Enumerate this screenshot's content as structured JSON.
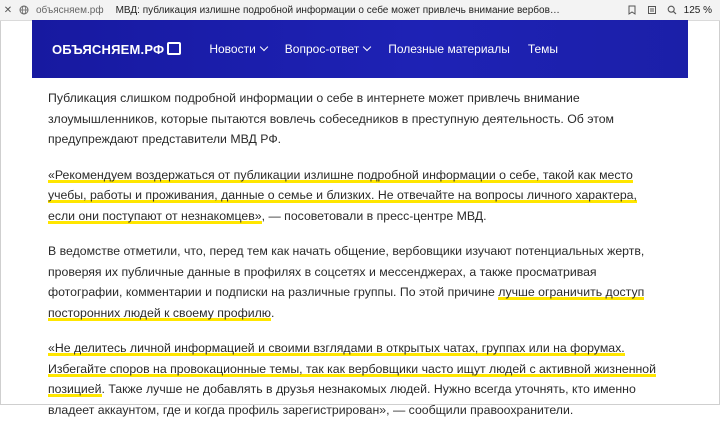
{
  "browser": {
    "url": "объясняем.рф",
    "tab_title": "МВД: публикация излишне подробной информации о себе может привлечь внимание вербовщик...",
    "zoom": "125 %",
    "icons": [
      "close-icon",
      "globe-icon",
      "bookmark-icon",
      "reader-icon",
      "search-icon"
    ]
  },
  "site": {
    "logo": "ОБЪЯСНЯЕМ.РФ",
    "nav": [
      {
        "label": "Новости",
        "has_dropdown": true
      },
      {
        "label": "Вопрос-ответ",
        "has_dropdown": true
      },
      {
        "label": "Полезные материалы",
        "has_dropdown": false
      },
      {
        "label": "Темы",
        "has_dropdown": false
      }
    ],
    "header_color": "#1a1fa8",
    "highlight_color": "#ffe600"
  },
  "article": {
    "p1": [
      "Публикация слишком подробной информации о себе в интернете может привлечь внимание",
      "злоумышленников, которые пытаются вовлечь собеседников в преступную деятельность. Об этом",
      "предупреждают представители МВД РФ."
    ],
    "p2": {
      "l1": "«Рекомендуем воздержаться от публикации излишне подробной информации о себе, такой как место",
      "l2": "учебы, работы и проживания, данные о семье и близких. Не отвечайте на вопросы личного характера,",
      "l3_hl": "если они поступают от незнакомцев»",
      "l3_rest": ", — посоветовали в пресс-центре МВД."
    },
    "p3": {
      "l1": "В ведомстве отметили, что, перед тем как начать общение, вербовщики изучают потенциальных жертв,",
      "l2": "проверяя их публичные данные в профилях в соцсетях и мессенджерах, а также просматривая",
      "l3_pre": "фотографии, комментарии и подписки на различные группы. По этой причине ",
      "l3_hl": "лучше ограничить доступ",
      "l4_hl": "посторонних людей к своему профилю",
      "l4_rest": "."
    },
    "p4": {
      "l1": "«Не делитесь личной информацией и своими взглядами в открытых чатах, группах или на форумах.",
      "l2": "Избегайте споров на провокационные темы, так как вербовщики часто ищут людей с активной жизненной",
      "l3_hl": "позицией",
      "l3_rest": ". Также лучше не добавлять в друзья незнакомых людей. Нужно всегда уточнять, кто именно",
      "l4": "владеет аккаунтом, где и когда профиль зарегистрирован», — сообщили правоохранители."
    }
  }
}
